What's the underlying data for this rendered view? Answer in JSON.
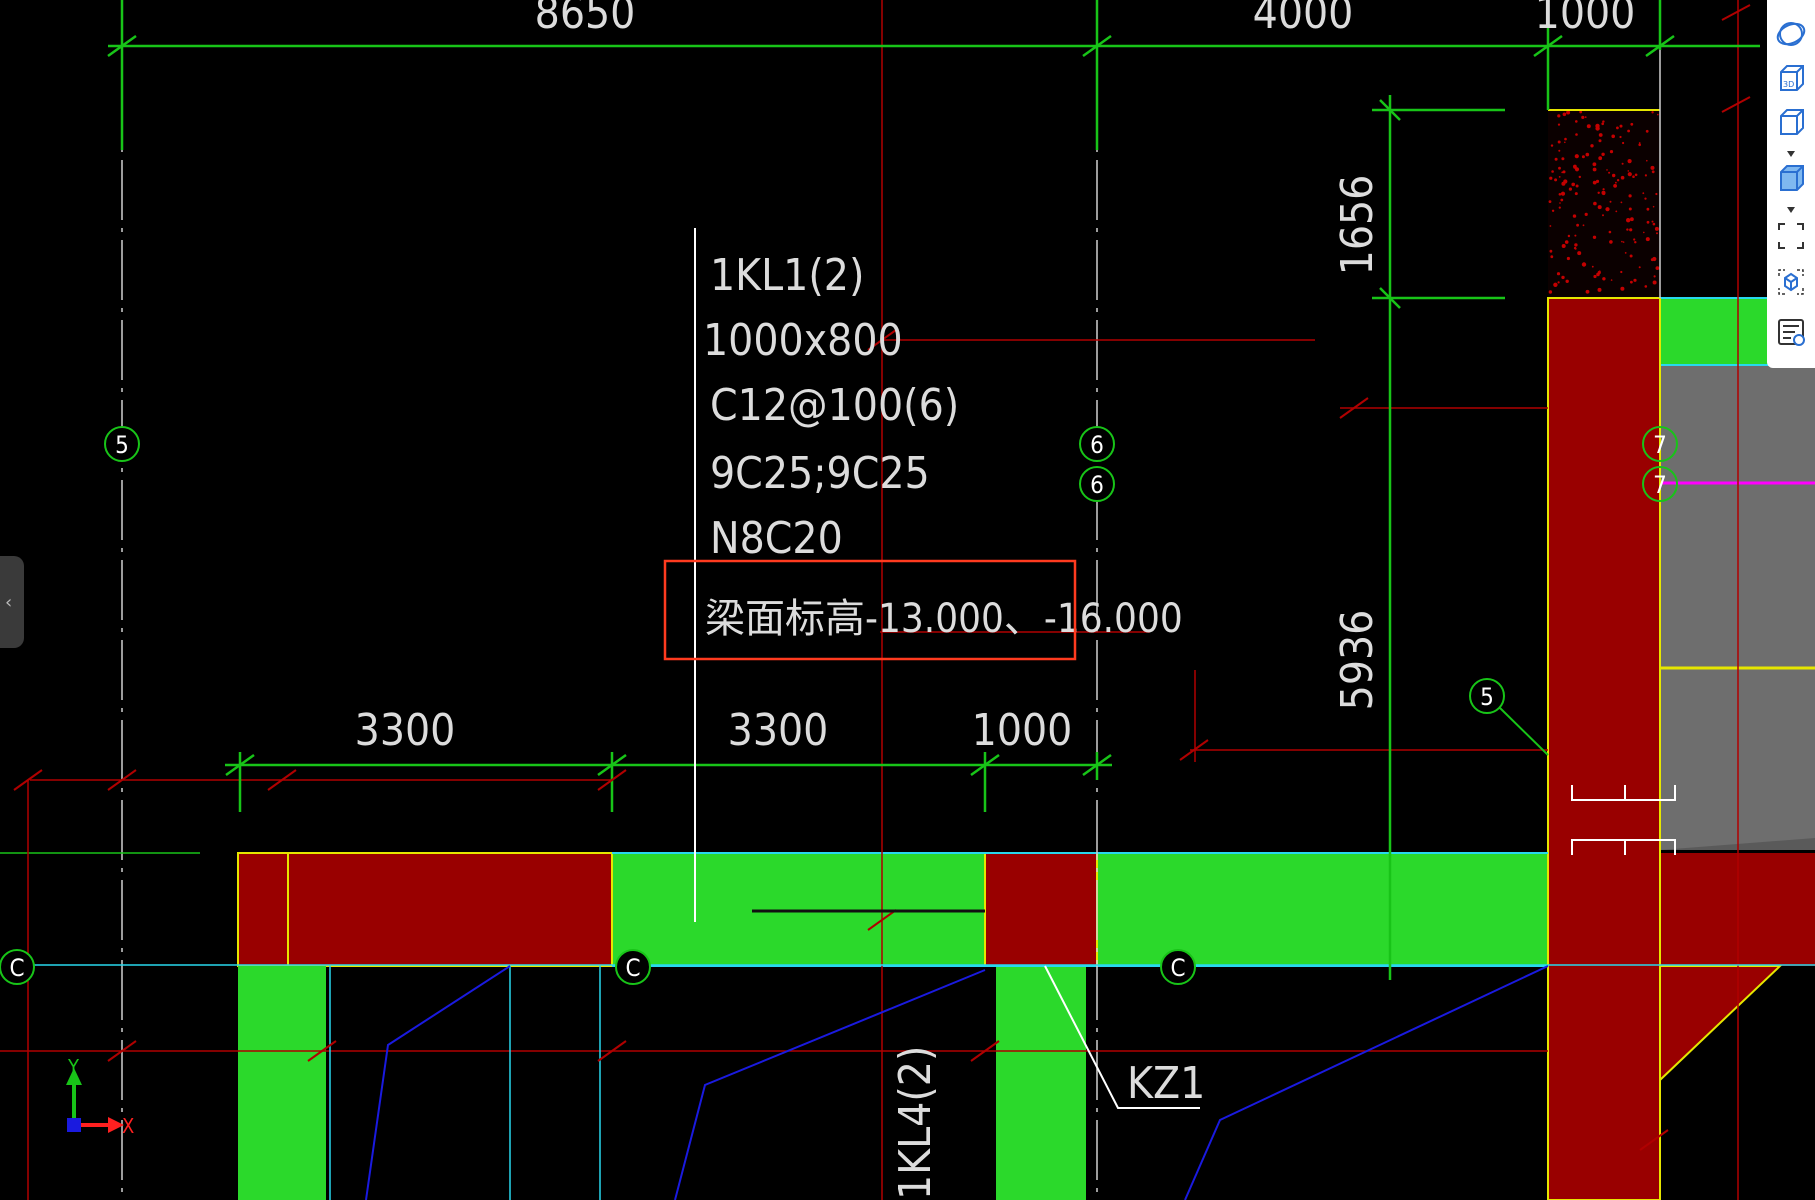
{
  "drawing": {
    "top_dimensions": [
      "8650",
      "4000",
      "1000"
    ],
    "right_dimensions": [
      "1656",
      "5936"
    ],
    "bottom_dimensions": [
      "3300",
      "3300",
      "1000"
    ],
    "beam_label": {
      "name": "1KL1(2)",
      "section": "1000x800",
      "stirrup": "C12@100(6)",
      "longitudinal": "9C25;9C25",
      "side_bars": "N8C20",
      "elevation": "梁面标高-13.000、-16.000"
    },
    "axis_bubbles": {
      "axis_5": "5",
      "axis_6a": "6",
      "axis_6b": "6",
      "axis_7a": "7",
      "axis_7b": "7",
      "axis_5_small": "5",
      "axis_c1": "C",
      "axis_c2": "C",
      "axis_c3": "C"
    },
    "column_label": "KZ1",
    "beam_label_vertical": "1KL4(2)",
    "ucs": {
      "y": "Y",
      "x": "X"
    }
  },
  "colors": {
    "background": "#000000",
    "green_dim": "#18c418",
    "red_axis": "#b00000",
    "beam_green": "#2bd92b",
    "column_red": "#990000",
    "yellow_edge": "#e6e600",
    "highlight_box": "#ff3b1f",
    "cyan": "#28d8ee",
    "blue": "#1a1adf",
    "magenta": "#ff00ff"
  },
  "toolbar": {
    "icons": [
      "orbit-icon",
      "view-3d-icon",
      "cube-view-icon",
      "cube-shaded-icon",
      "fullscreen-icon",
      "model-box-icon",
      "properties-list-icon"
    ]
  }
}
